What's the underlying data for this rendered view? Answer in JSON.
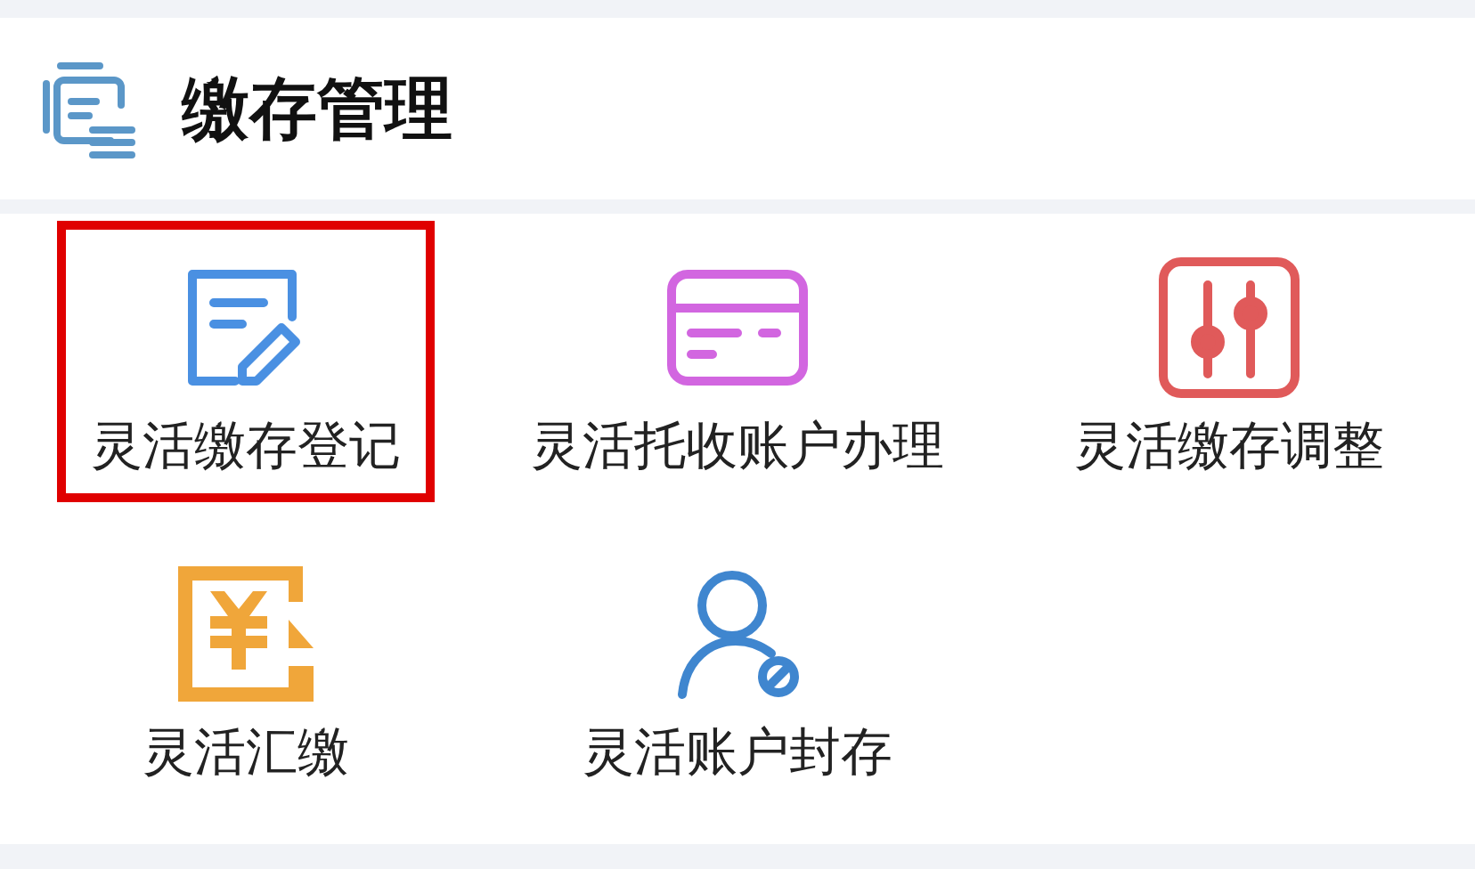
{
  "header": {
    "title": "缴存管理"
  },
  "items": [
    {
      "label": "灵活缴存登记",
      "kind": "note",
      "color": "#4a90e2",
      "highlighted": true
    },
    {
      "label": "灵活托收账户办理",
      "kind": "card",
      "color": "#d266e0",
      "highlighted": false
    },
    {
      "label": "灵活缴存调整",
      "kind": "sliders",
      "color": "#e05a5a",
      "highlighted": false
    },
    {
      "label": "灵活汇缴",
      "kind": "yen",
      "color": "#f0a63a",
      "highlighted": false
    },
    {
      "label": "灵活账户封存",
      "kind": "user",
      "color": "#3f86cf",
      "highlighted": false
    }
  ]
}
